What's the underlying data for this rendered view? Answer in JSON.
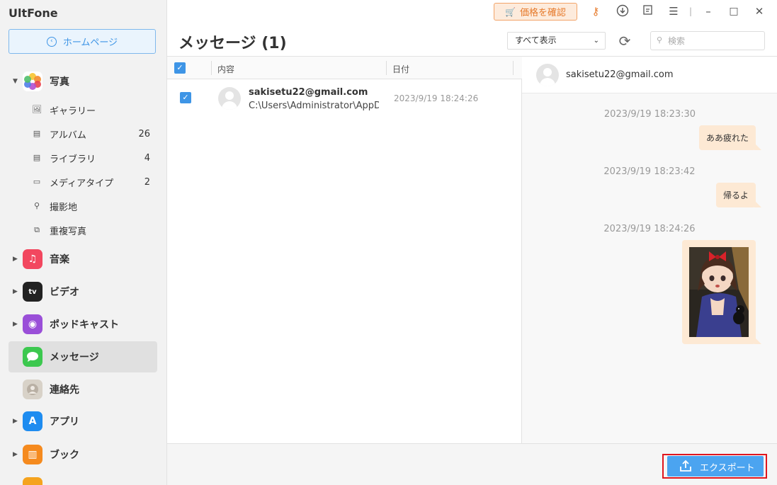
{
  "app": {
    "name": "UltFone"
  },
  "sidebar": {
    "home_label": "ホームページ",
    "photos": {
      "label": "写真",
      "items": [
        {
          "label": "ギャラリー",
          "count": "",
          "icon": "image-icon"
        },
        {
          "label": "アルバム",
          "count": "26",
          "icon": "album-icon"
        },
        {
          "label": "ライブラリ",
          "count": "4",
          "icon": "library-icon"
        },
        {
          "label": "メディアタイプ",
          "count": "2",
          "icon": "video-camera-icon"
        },
        {
          "label": "撮影地",
          "count": "",
          "icon": "location-pin-icon"
        },
        {
          "label": "重複写真",
          "count": "",
          "icon": "duplicate-photos-icon"
        }
      ]
    },
    "categories": [
      {
        "label": "音楽",
        "icon": "music-icon",
        "color": "#f2475f"
      },
      {
        "label": "ビデオ",
        "icon": "apple-tv-icon",
        "color": "#222222"
      },
      {
        "label": "ポッドキャスト",
        "icon": "podcast-icon",
        "color": "#9a4fd8"
      },
      {
        "label": "メッセージ",
        "icon": "messages-icon",
        "color": "#3cc84f",
        "active": true
      },
      {
        "label": "連絡先",
        "icon": "contacts-icon",
        "color": "#c8c0b4"
      },
      {
        "label": "アプリ",
        "icon": "app-store-icon",
        "color": "#1e8cf0"
      },
      {
        "label": "ブック",
        "icon": "books-icon",
        "color": "#f58a1e"
      }
    ]
  },
  "topbar": {
    "price_label": "価格を確認"
  },
  "page": {
    "title": "メッセージ (1)",
    "filter_value": "すべて表示",
    "search_placeholder": "検索"
  },
  "list": {
    "columns": [
      "内容",
      "日付"
    ],
    "rows": [
      {
        "name": "sakisetu22@gmail.com",
        "path": "C:\\Users\\Administrator\\AppData",
        "date": "2023/9/19 18:24:26",
        "checked": true
      }
    ]
  },
  "chat": {
    "contact": "sakisetu22@gmail.com",
    "messages": [
      {
        "timestamp": "2023/9/19 18:23:30",
        "text": "ああ疲れた"
      },
      {
        "timestamp": "2023/9/19 18:23:42",
        "text": "帰るよ"
      },
      {
        "timestamp": "2023/9/19 18:24:26",
        "image": "anime-girl-image"
      }
    ]
  },
  "footer": {
    "export_label": "エクスポート"
  },
  "colors": {
    "accent": "#3e95e6",
    "price_orange": "#e67a2b",
    "bubble": "#fde9d4",
    "highlight": "#e0161e"
  }
}
